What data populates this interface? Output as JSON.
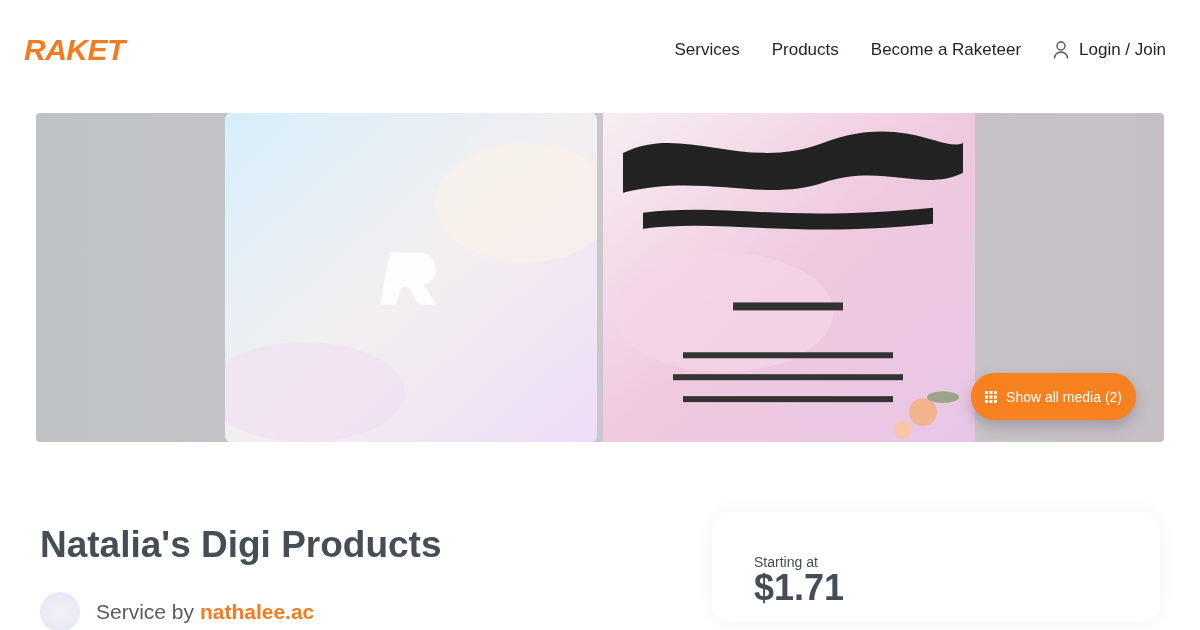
{
  "header": {
    "logo": "RAKET",
    "nav": [
      {
        "label": "Services"
      },
      {
        "label": "Products"
      },
      {
        "label": "Become a Raketeer"
      }
    ],
    "login": "Login / Join"
  },
  "gallery": {
    "show_all_button": "Show all media (2)"
  },
  "service": {
    "title": "Natalia's Digi Products",
    "by_label": "Service by",
    "seller": "nathalee.ac"
  },
  "price_card": {
    "label": "Starting at",
    "price": "$1.71"
  }
}
